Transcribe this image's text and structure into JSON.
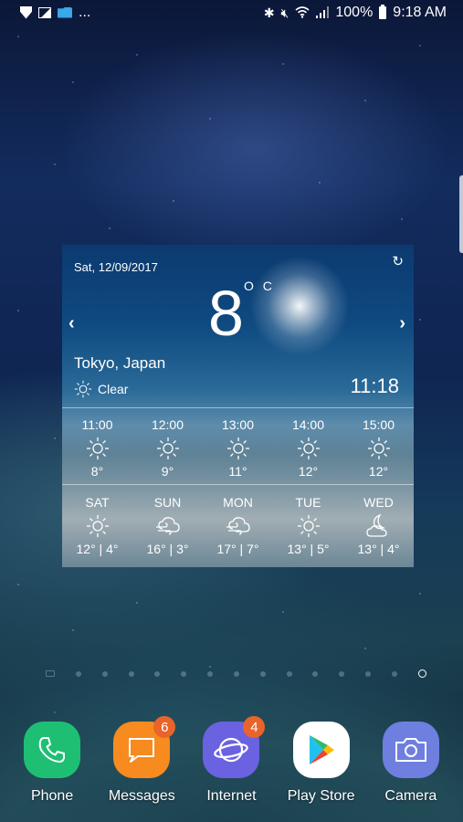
{
  "status_bar": {
    "notification_icons": [
      "shield-icon",
      "gallery-icon",
      "folder-icon"
    ],
    "overflow": "...",
    "system_icons": [
      "bluetooth-icon",
      "mute-icon",
      "wifi-icon",
      "signal-icon"
    ],
    "battery": "100%",
    "time": "9:18 AM",
    "colors": {
      "folder": "#3aa7e8"
    }
  },
  "weather_widget": {
    "date": "Sat, 12/09/2017",
    "temperature": "8",
    "unit": "O C",
    "city": "Tokyo, Japan",
    "condition": "Clear",
    "local_time": "11:18",
    "prev_glyph": "‹",
    "next_glyph": "›",
    "refresh_glyph": "↻",
    "hourly": [
      {
        "time": "11:00",
        "icon": "sun-icon",
        "temp": "8°"
      },
      {
        "time": "12:00",
        "icon": "sun-icon",
        "temp": "9°"
      },
      {
        "time": "13:00",
        "icon": "sun-icon",
        "temp": "11°"
      },
      {
        "time": "14:00",
        "icon": "sun-icon",
        "temp": "12°"
      },
      {
        "time": "15:00",
        "icon": "sun-icon",
        "temp": "12°"
      }
    ],
    "daily": [
      {
        "day": "SAT",
        "icon": "sun-icon",
        "range": "12° | 4°"
      },
      {
        "day": "SUN",
        "icon": "windy-cloud-icon",
        "range": "16° | 3°"
      },
      {
        "day": "MON",
        "icon": "windy-cloud-icon",
        "range": "17° | 7°"
      },
      {
        "day": "TUE",
        "icon": "sun-icon",
        "range": "13° | 5°"
      },
      {
        "day": "WED",
        "icon": "moon-cloud-icon",
        "range": "13° | 4°"
      }
    ]
  },
  "pager": {
    "page_count": 15,
    "current_page": 15
  },
  "dock": {
    "apps": [
      {
        "name": "Phone",
        "color": "#1fbf73",
        "badge": null
      },
      {
        "name": "Messages",
        "color": "#f78b1f",
        "badge": "6"
      },
      {
        "name": "Internet",
        "color": "#6a62e0",
        "badge": "4"
      },
      {
        "name": "Play Store",
        "color": "#ffffff",
        "badge": null
      },
      {
        "name": "Camera",
        "color": "#6e7fe0",
        "badge": null
      }
    ],
    "badge_color": "#e8642a"
  }
}
